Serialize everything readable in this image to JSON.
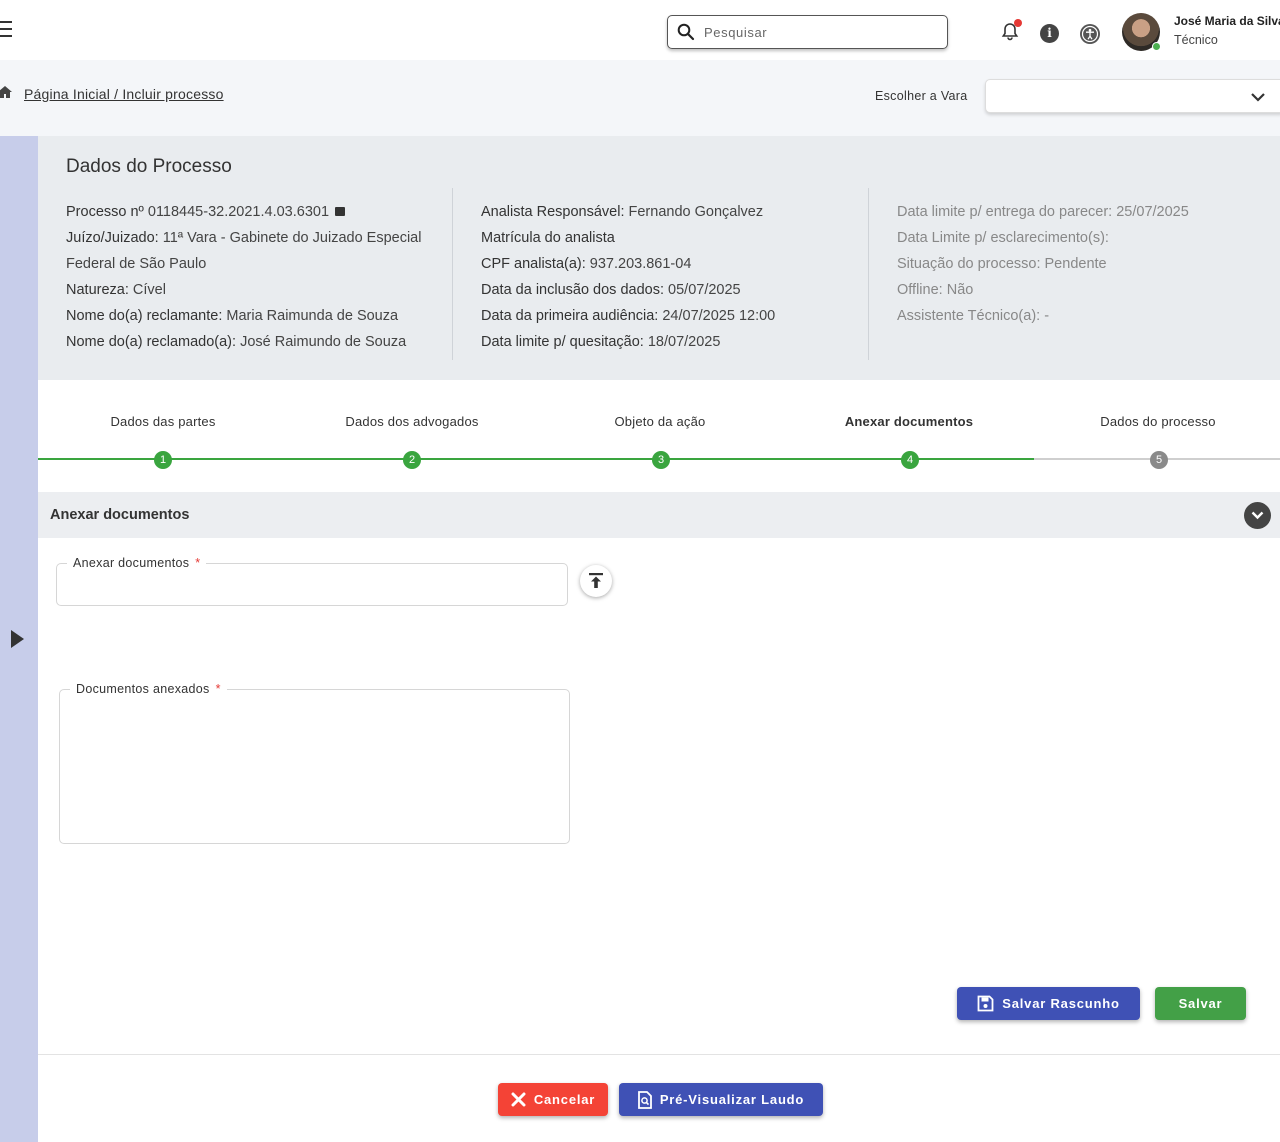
{
  "header": {
    "search_placeholder": "Pesquisar",
    "user_name": "José Maria da Silva",
    "user_role": "Técnico"
  },
  "breadcrumb": "Página Inicial / Incluir processo",
  "vara": {
    "label": "Escolher a Vara",
    "value": ""
  },
  "process": {
    "title": "Dados do Processo",
    "col1": [
      {
        "k": "Processo nº",
        "v": "0118445-32.2021.4.03.6301"
      },
      {
        "k": "Juízo/Juizado:",
        "v": "11ª Vara - Gabinete do Juizado Especial Federal de São Paulo"
      },
      {
        "k": "Natureza:",
        "v": "Cível"
      },
      {
        "k": "Nome do(a) reclamante:",
        "v": "Maria Raimunda de Souza"
      },
      {
        "k": "Nome do(a) reclamado(a):",
        "v": "José Raimundo de Souza"
      }
    ],
    "col2": [
      {
        "k": "Analista Responsável:",
        "v": "Fernando Gonçalvez"
      },
      {
        "k": "Matrícula do analista",
        "v": ""
      },
      {
        "k": "CPF analista(a):",
        "v": "937.203.861-04"
      },
      {
        "k": "Data da inclusão dos dados:",
        "v": "05/07/2025"
      },
      {
        "k": "Data da primeira audiência:",
        "v": "24/07/2025  12:00"
      },
      {
        "k": "Data limite p/ quesitação:",
        "v": "18/07/2025"
      }
    ],
    "col3": [
      {
        "k": "Data limite p/ entrega do parecer:",
        "v": "25/07/2025"
      },
      {
        "k": "Data Limite p/ esclarecimento(s):",
        "v": ""
      },
      {
        "k": "Situação do processo:",
        "v": "Pendente"
      },
      {
        "k": "Offline:",
        "v": "Não"
      },
      {
        "k": "Assistente Técnico(a):",
        "v": "-"
      }
    ]
  },
  "steps": [
    {
      "label": "Dados das partes",
      "num": "1",
      "status": "done"
    },
    {
      "label": "Dados dos advogados",
      "num": "2",
      "status": "done"
    },
    {
      "label": "Objeto da ação",
      "num": "3",
      "status": "done"
    },
    {
      "label": "Anexar documentos",
      "num": "4",
      "status": "active"
    },
    {
      "label": "Dados do processo",
      "num": "5",
      "status": "todo"
    }
  ],
  "section": {
    "title": "Anexar documentos",
    "attach_label": "Anexar documentos",
    "attached_label": "Documentos anexados",
    "required_mark": "*"
  },
  "buttons": {
    "save_draft": "Salvar Rascunho",
    "save": "Salvar",
    "cancel": "Cancelar",
    "preview": "Pré-Visualizar Laudo"
  },
  "colors": {
    "primary": "#3f51b5",
    "success": "#43a047",
    "danger": "#f44336",
    "step_done": "#3aa53f"
  }
}
